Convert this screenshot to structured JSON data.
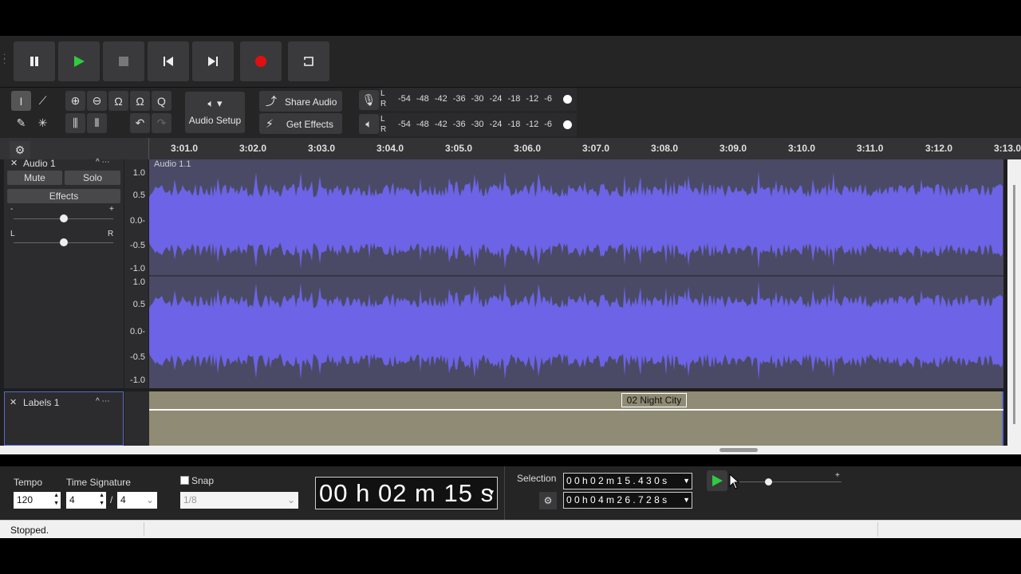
{
  "transport": {
    "pause": "pause",
    "play": "play",
    "stop": "stop",
    "skip_start": "skip-to-start",
    "skip_end": "skip-to-end",
    "record": "record",
    "loop": "loop"
  },
  "colors": {
    "play": "#2ecc40",
    "record": "#e01010",
    "wave": "#6c63e6",
    "wave_bg": "#4a4a66",
    "label_bg": "#8f8b74"
  },
  "toolbar": {
    "audio_setup": "Audio Setup",
    "share_audio": "Share Audio",
    "get_effects": "Get Effects"
  },
  "meters": {
    "scale": [
      "-54",
      "-48",
      "-42",
      "-36",
      "-30",
      "-24",
      "-18",
      "-12",
      "-6"
    ],
    "L": "L",
    "R": "R"
  },
  "ruler": {
    "ticks": [
      "3:01.0",
      "3:02.0",
      "3:03.0",
      "3:04.0",
      "3:05.0",
      "3:06.0",
      "3:07.0",
      "3:08.0",
      "3:09.0",
      "3:10.0",
      "3:11.0",
      "3:12.0",
      "3:13.0"
    ]
  },
  "audio_track": {
    "name": "Audio 1",
    "clip_name": "Audio 1.1",
    "mute": "Mute",
    "solo": "Solo",
    "effects": "Effects",
    "gain_minus": "-",
    "gain_plus": "+",
    "pan_left": "L",
    "pan_right": "R",
    "y_labels": [
      "1.0",
      "0.5",
      "0.0-",
      "-0.5",
      "-1.0"
    ]
  },
  "label_track": {
    "name": "Labels 1",
    "label_text": "02 Night City"
  },
  "bottom": {
    "tempo_label": "Tempo",
    "tempo": "120",
    "time_sig_label": "Time Signature",
    "ts_num": "4",
    "ts_sep": "/",
    "ts_den": "4",
    "snap_label": "Snap",
    "snap_value": "1/8",
    "time": "00 h 02 m 15 s",
    "selection_label": "Selection",
    "sel_start": "0 0 h 0 2 m 1 5 . 4 3 0 s",
    "sel_end": "0 0 h 0 4 m 2 6 . 7 2 8 s"
  },
  "status": {
    "text": "Stopped."
  }
}
